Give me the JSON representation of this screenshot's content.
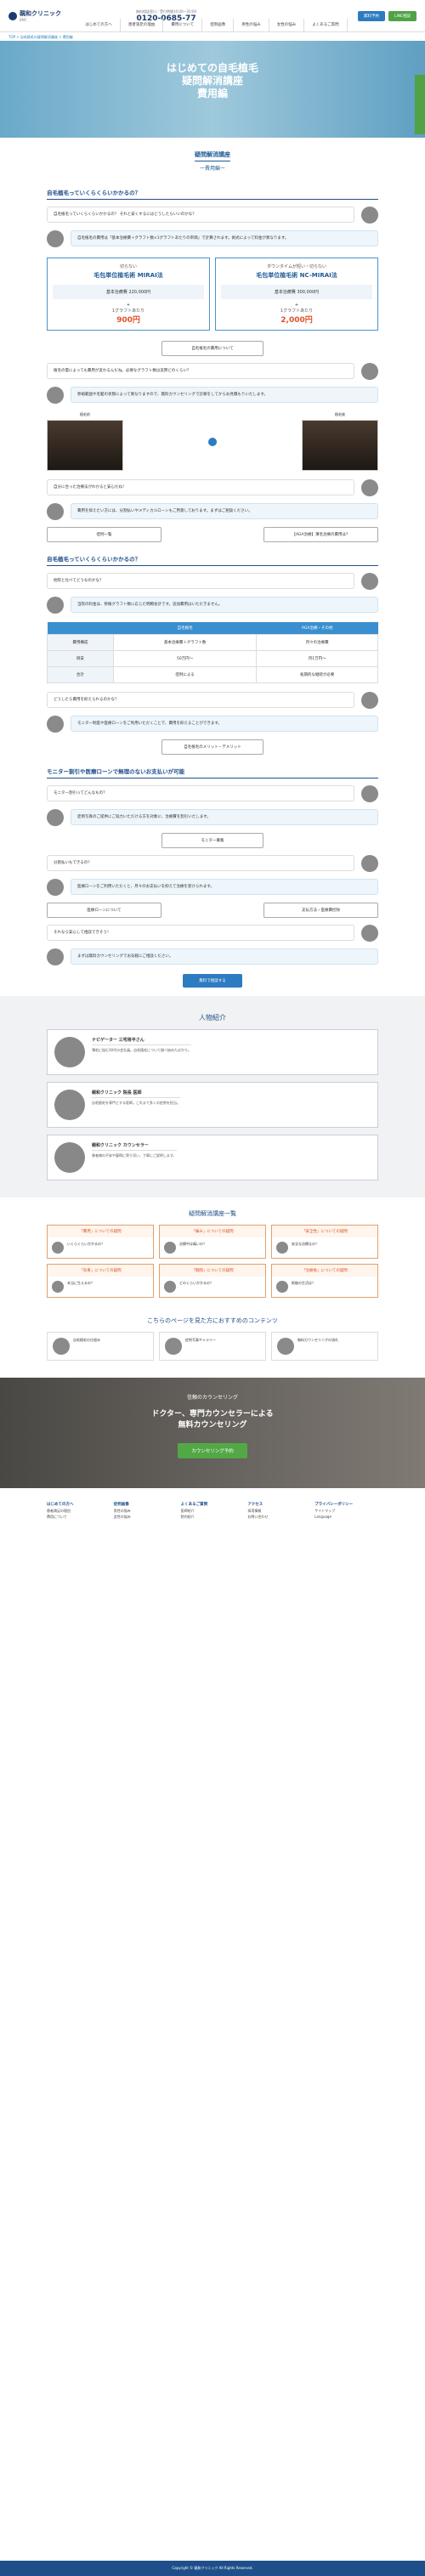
{
  "header": {
    "logo_name": "親和クリニック",
    "logo_tag": "BMC",
    "tel_label": "0120-0685-77",
    "tel_note": "無料相談窓口／受付時間10:00〜20:00",
    "btn_reserve": "無料予約",
    "btn_line": "LINE相談",
    "nav": [
      "はじめての方へ",
      "患者満足の理由",
      "費用について",
      "症例画像",
      "男性の悩み",
      "女性の悩み",
      "よくあるご質問"
    ],
    "colors": {
      "primary": "#1f4f8a",
      "reserve": "#2d7cc1",
      "line": "#4fa345"
    }
  },
  "breadcrumb": "TOP > 自毛植毛の疑問解消講座 > 費用編",
  "hero": {
    "line1": "はじめての自毛植毛",
    "line2": "疑問解消講座",
    "line3": "費用編",
    "side": "無料カウンセリング予約"
  },
  "sub": {
    "title": "疑問解消講座",
    "subtitle": "ー費用編ー"
  },
  "s1": {
    "heading": "自毛植毛っていくらくらいかかるの？",
    "q": "自毛植毛っていくらくらいかかるの？ それと安くするにはどうしたらいいのかな？",
    "a": "自毛植毛の費用は「基本治療費＋グラフト数×1グラフトあたりの単価」で計算されます。術式によって料金が異なります。",
    "left": {
      "h": "切らない",
      "name": "毛包単位植毛術 MIRAI法",
      "base": "基本治療費 220,000円",
      "plus": "+",
      "unit_label": "1グラフトあたり",
      "unit": "900円"
    },
    "right": {
      "h": "ダウンタイムが短い・切らない",
      "name": "毛包単位植毛術 NC-MIRAI法",
      "base": "基本治療費 300,000円",
      "plus": "+",
      "unit_label": "1グラフトあたり",
      "unit": "2,000円"
    },
    "link": "自毛植毛の費用について",
    "q2": "植毛の量によっても費用が変わるんだね。必要なグラフト数は実際どのくらい？",
    "a2": "移植範囲や毛髪の状態によって異なりますので、無料カウンセリングで診察をしてからお見積もりいたします。",
    "before": "植毛前",
    "after": "植毛後",
    "q3": "自分に合った治療法がわかると安心だね！",
    "a3": "費用を抑えたい方には、分割払いやメディカルローンもご用意しております。まずはご相談ください。",
    "b_left": "症例一覧",
    "b_right": "【AGA治療】薄毛治療の費用は？"
  },
  "s2": {
    "heading": "自毛植毛っていくらくらいかかるの？",
    "q": "他院と比べてどうなのかな？",
    "a": "当院の料金は、移植グラフト数に応じた明瞭会計です。追加費用はいただきません。",
    "table": {
      "headers": [
        "",
        "自毛植毛",
        "AGA治療・その他"
      ],
      "rows": [
        [
          "費用構成",
          "基本治療費＋グラフト数",
          "月々の治療費"
        ],
        [
          "目安",
          "50万円〜",
          "月1万円〜"
        ],
        [
          "合計",
          "症例による",
          "長期的な継続が必要"
        ]
      ]
    },
    "q2": "どうしたら費用を抑えられるのかな？",
    "a2": "モニター制度や医療ローンをご利用いただくことで、費用を抑えることができます。",
    "link": "自毛植毛のメリット・デメリット"
  },
  "s3": {
    "heading": "モニター割引や医療ローンで無理のないお支払いが可能",
    "q": "モニター割引ってどんなもの？",
    "a": "症例写真のご提供にご協力いただける方を対象に、治療費を割引いたします。",
    "link": "モニター募集",
    "q2": "分割払いもできるの？",
    "a2": "医療ローンをご利用いただくと、月々のお支払いを抑えて治療を受けられます。",
    "b_left": "医療ローンについて",
    "b_right": "支払方法・医療費控除",
    "q3": "それなら安心して相談できそう！",
    "a3": "まずは無料カウンセリングでお気軽にご相談ください。",
    "btn": "無料で相談する"
  },
  "people": {
    "title": "人物紹介",
    "list": [
      {
        "name": "ナビゲーター 三宅将平さん",
        "desc": "薄毛に悩む30代の会社員。自毛植毛について調べ始めたばかり。"
      },
      {
        "name": "親和クリニック 院長 医師",
        "desc": "自毛植毛を専門とする医師。これまで多くの症例を担当。"
      },
      {
        "name": "親和クリニック カウンセラー",
        "desc": "患者様の不安や疑問に寄り添い、丁寧にご説明します。"
      }
    ]
  },
  "list": {
    "title": "疑問解消講座一覧",
    "items": [
      {
        "h": "「費用」についての疑問",
        "t": "いくらくらいかかるの？"
      },
      {
        "h": "「痛み」についての疑問",
        "t": "治療中は痛いの？"
      },
      {
        "h": "「安全性」についての疑問",
        "t": "安全な治療なの？"
      },
      {
        "h": "「効果」についての疑問",
        "t": "本当に生えるの？"
      },
      {
        "h": "「期間」についての疑問",
        "t": "どのくらいかかるの？"
      },
      {
        "h": "「治療後」についての疑問",
        "t": "術後の生活は？"
      }
    ]
  },
  "rec": {
    "title": "こちらのページを見た方におすすめのコンテンツ",
    "items": [
      "自毛植毛の仕組み",
      "症例写真ギャラリー",
      "無料カウンセリングの流れ"
    ]
  },
  "banner": {
    "s1": "信頼のカウンセリング",
    "s2": "ドクター、専門カウンセラーによる",
    "s3": "無料カウンセリング",
    "btn": "カウンセリング予約"
  },
  "footer": {
    "cols": [
      [
        "はじめての方へ",
        "患者満足の理由",
        "費用について"
      ],
      [
        "症例画像",
        "男性の悩み",
        "女性の悩み"
      ],
      [
        "よくあるご質問",
        "医師紹介",
        "院内紹介"
      ],
      [
        "アクセス",
        "採用情報",
        "お問い合わせ"
      ],
      [
        "プライバシーポリシー",
        "サイトマップ",
        "Language"
      ]
    ],
    "copy": "Copyright © 親和クリニック All Rights Reserved."
  }
}
